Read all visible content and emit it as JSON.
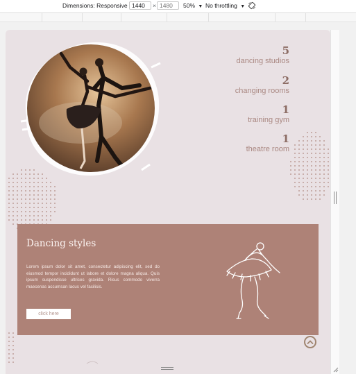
{
  "devtools": {
    "dimensions_label": "Dimensions: Responsive",
    "width_value": "1440",
    "height_placeholder": "1480",
    "times_symbol": "×",
    "zoom": "50%",
    "throttling": "No throttling",
    "rotate_icon": "rotate-device-icon",
    "caret_icon": "caret-down-icon"
  },
  "page": {
    "hero": {
      "image_icon": "dancers-photo",
      "stats": [
        {
          "number": "5",
          "label": "dancing studios"
        },
        {
          "number": "2",
          "label": "changing rooms"
        },
        {
          "number": "1",
          "label": "training gym"
        },
        {
          "number": "1",
          "label": "theatre room"
        }
      ]
    },
    "styles_card": {
      "title": "Dancing styles",
      "body": "Lorem ipsum dolor sit amet, consectetur adipiscing elit, sed do eiusmod tempor incididunt ut labore et dolore magna aliqua. Quis ipsum suspendisse ultrices gravida. Risus commodo viverra maecenas accumsan lacus vel facilisis.",
      "button_label": "click here",
      "illustration_icon": "ballerina-line-art"
    },
    "scroll_top_icon": "chevron-up-icon"
  },
  "colors": {
    "background": "#e9e1e4",
    "card": "#ae8277",
    "accent_text": "#a98781",
    "dots": "#b08a82"
  }
}
